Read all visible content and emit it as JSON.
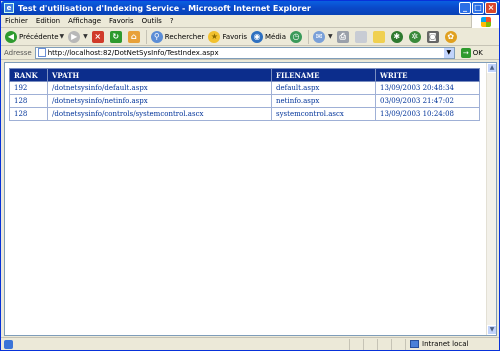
{
  "window": {
    "title": "Test d'utilisation d'Indexing Service - Microsoft Internet Explorer"
  },
  "menu": [
    "Fichier",
    "Edition",
    "Affichage",
    "Favoris",
    "Outils",
    "?"
  ],
  "toolbar": {
    "back_label": "Précédente",
    "search_label": "Rechercher",
    "favorites_label": "Favoris",
    "media_label": "Média"
  },
  "address": {
    "label": "Adresse",
    "url": "http://localhost:82/DotNetSysInfo/TestIndex.aspx",
    "go_label": "OK"
  },
  "table": {
    "headers": [
      "RANK",
      "VPATH",
      "FILENAME",
      "WRITE"
    ],
    "rows": [
      [
        "192",
        "/dotnetsysinfo/default.aspx",
        "default.aspx",
        "13/09/2003 20:48:34"
      ],
      [
        "128",
        "/dotnetsysinfo/netinfo.aspx",
        "netinfo.aspx",
        "03/09/2003 21:47:02"
      ],
      [
        "128",
        "/dotnetsysinfo/controls/systemcontrol.ascx",
        "systemcontrol.ascx",
        "13/09/2003 10:24:08"
      ]
    ]
  },
  "status": {
    "zone_label": "Intranet local"
  },
  "colors": {
    "header_bg": "#0c2d8c",
    "link_text": "#003399",
    "titlebar": "#0a48c8"
  }
}
